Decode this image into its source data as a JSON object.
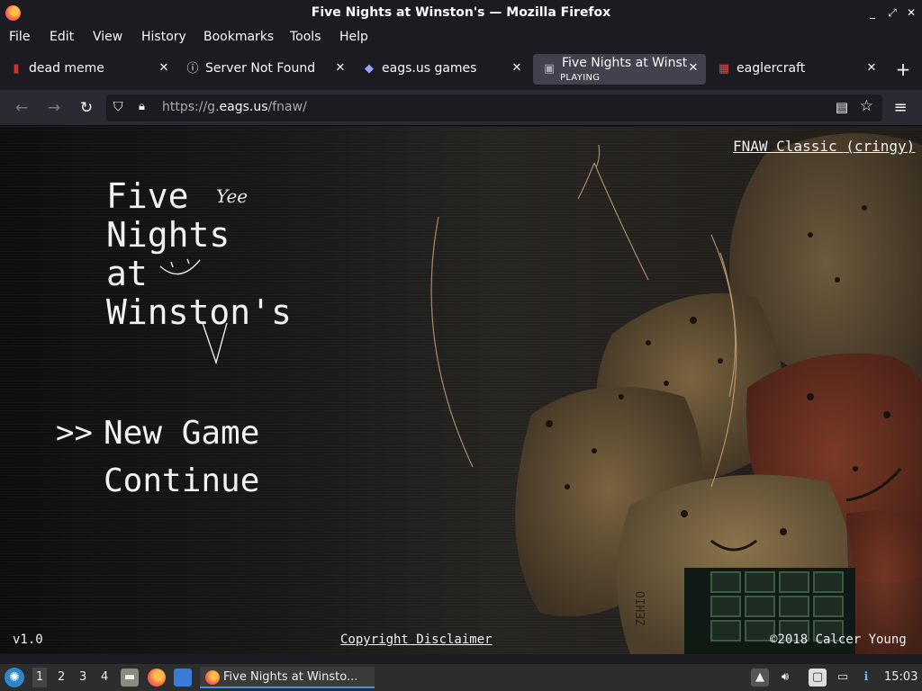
{
  "window": {
    "title": "Five Nights at Winston's — Mozilla Firefox",
    "controls": [
      "_",
      "⤢",
      "✕"
    ]
  },
  "menu": [
    "File",
    "Edit",
    "View",
    "History",
    "Bookmarks",
    "Tools",
    "Help"
  ],
  "tabs": [
    {
      "label": "dead meme",
      "favicon": "soda-can-icon"
    },
    {
      "label": "Server Not Found",
      "favicon": "info-icon"
    },
    {
      "label": "eags.us games",
      "favicon": "game-icon"
    },
    {
      "label": "Five Nights at Winsto",
      "sublabel": "PLAYING",
      "favicon": "fnaw-icon",
      "active": true
    },
    {
      "label": "eaglercraft",
      "favicon": "eaglercraft-icon"
    }
  ],
  "navbar": {
    "url_prefix": "https://g.",
    "url_domain": "eags.us",
    "url_path": "/fnaw/"
  },
  "game": {
    "title": "Five\nNights\nat\nWinston's",
    "scribble_text": "Yee",
    "menu_selector": ">>",
    "menu_items": [
      "New Game",
      "Continue"
    ],
    "alt_version": "FNAW Classic (cringy)",
    "version": "v1.0",
    "disclaimer": "Copyright Disclaimer",
    "copyright": "©2018 Calcer Young",
    "cookie_label": "ZEHIO"
  },
  "taskbar": {
    "workspaces": [
      "1",
      "2",
      "3",
      "4"
    ],
    "task_label": "Five Nights at Winsto...",
    "clock": "15:03"
  },
  "colors": {
    "chrome_bg": "#1c1b22",
    "toolbar_bg": "#2b2a33",
    "active_tab": "#42414d",
    "taskbar_bg": "#2d2d2d"
  }
}
